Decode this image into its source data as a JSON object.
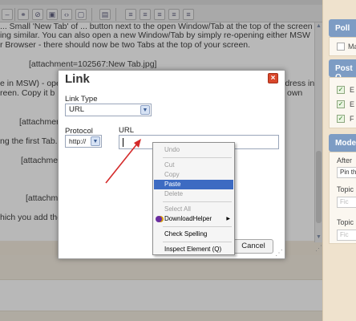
{
  "editor": {
    "lines": [
      "... Small 'New Tab' of ... button next to the open Window/Tab at the top of the screen",
      "ing similar. You can also open a new Window/Tab by simply re-opening either MSW",
      "r Browser - there should now be two Tabs at the top of your screen.",
      "[attachment=102567:New Tab.jpg]",
      "e in MSW) - open the Site and the Page you want to Link to. Highlight the Address in",
      "reen. Copy it b",
      "own",
      "[attachmen",
      "ng the first Tab. I",
      "[attachmer",
      "[attachme",
      "hich you add the"
    ]
  },
  "sidebar": {
    "poll_heading": "Poll",
    "poll_item": "Ma",
    "post_heading": "Post O",
    "post_options": [
      "E",
      "E",
      "F"
    ],
    "mod_heading": "Mode",
    "after_label": "After",
    "pin_label": "Pin th",
    "topic1_label": "Topic",
    "topic1_placeholder": "Fic",
    "topic2_label": "Topic",
    "topic2_placeholder": "Fic"
  },
  "dialog": {
    "title": "Link",
    "close_glyph": "×",
    "link_type_label": "Link Type",
    "link_type_value": "URL",
    "protocol_label": "Protocol",
    "protocol_value": "http://",
    "url_label": "URL",
    "url_value": "",
    "cancel_label": "Cancel"
  },
  "context_menu": {
    "undo": "Undo",
    "cut": "Cut",
    "copy": "Copy",
    "paste": "Paste",
    "delete": "Delete",
    "select_all": "Select All",
    "downloadhelper": "DownloadHelper",
    "check_spelling": "Check Spelling",
    "inspect_element": "Inspect Element (Q)"
  },
  "colors": {
    "dialog_close": "#d9472b",
    "menu_highlight": "#3d6bc2",
    "sidebar_header": "#7d9cc4",
    "arrow": "#d42a2a"
  }
}
